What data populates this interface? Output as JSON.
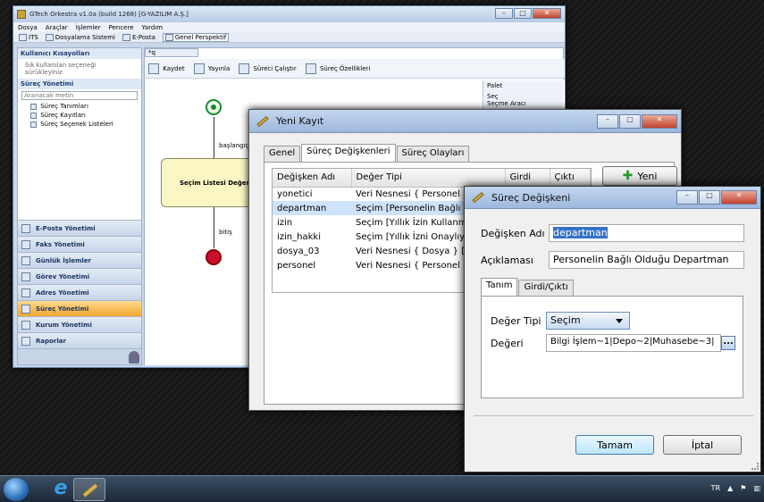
{
  "main_window": {
    "title": "GTech Orkestra v1.0a (build 1268) [G-YAZILIM A.Ş.]",
    "menu": [
      "Dosya",
      "Araçlar",
      "İşlemler",
      "Pencere",
      "Yardım"
    ],
    "toolbar": [
      "ITS",
      "Dosyalama Sistemi",
      "E-Posta",
      "Genel Perspektif"
    ],
    "left_panel": {
      "shortcuts_header": "Kullanıcı Kısayolları",
      "shortcuts_hint": "Sık kullanılan seçeneği sürükleyiniz",
      "process_header": "Süreç Yönetimi",
      "search_placeholder": "Aranacak metin",
      "items": [
        "Süreç Tanımları",
        "Süreç Kayıtları",
        "Süreç Seçenek Listeleri"
      ]
    },
    "modules": [
      "E-Posta Yönetimi",
      "Faks Yönetimi",
      "Günlük İşlemler",
      "Görev Yönetimi",
      "Adres Yönetimi",
      "Süreç Yönetimi",
      "Kurum Yönetimi",
      "Raporlar"
    ],
    "selected_module": "Süreç Yönetimi",
    "editor_tab": "*q",
    "editor_toolbar": [
      "Kaydet",
      "Yayınla",
      "Süreci Çalıştır",
      "Süreç Özellikleri"
    ],
    "palette": {
      "title": "Palet",
      "item": "Seç",
      "partial": "Seçme Aracı"
    },
    "diagram": {
      "flow_start": "başlangıç",
      "task": "Seçim Listesi Değer",
      "flow_end": "bitiş"
    }
  },
  "dialog_new_record": {
    "title": "Yeni Kayıt",
    "tabs": [
      "Genel",
      "Süreç Değişkenleri",
      "Süreç Olayları"
    ],
    "active_tab": "Süreç Değişkenleri",
    "columns": [
      "Değişken Adı",
      "Değer Tipi",
      "Girdi",
      "Çıktı"
    ],
    "rows": [
      {
        "name": "yonetici",
        "type": "Veri Nesnesi { Personel }"
      },
      {
        "name": "departman",
        "type": "Seçim [Personelin Bağlı Ol"
      },
      {
        "name": "izin",
        "type": "Seçim [Yıllık İzin Kullanma"
      },
      {
        "name": "izin_hakki",
        "type": "Seçim [Yıllık İzni Onaylıyor"
      },
      {
        "name": "dosya_03",
        "type": "Veri Nesnesi { Dosya } [Dos"
      },
      {
        "name": "personel",
        "type": "Veri Nesnesi { Personel } [İl"
      }
    ],
    "selected_row": "departman",
    "new_button": "Yeni"
  },
  "dialog_variable": {
    "title": "Süreç Değişkeni",
    "name_label": "Değişken Adı",
    "name_value": "departman",
    "desc_label": "Açıklaması",
    "desc_value": "Personelin Bağlı Olduğu Departman",
    "tabs": [
      "Tanım",
      "Girdi/Çıktı"
    ],
    "active_tab": "Tanım",
    "type_label": "Değer Tipi",
    "type_value": "Seçim",
    "value_label": "Değeri",
    "value_value": "Bilgi İşlem~1|Depo~2|Muhasebe~3|",
    "browse_label": "...",
    "ok_button": "Tamam",
    "cancel_button": "İptal"
  },
  "taskbar": {
    "language": "TR",
    "time_partial": ""
  }
}
